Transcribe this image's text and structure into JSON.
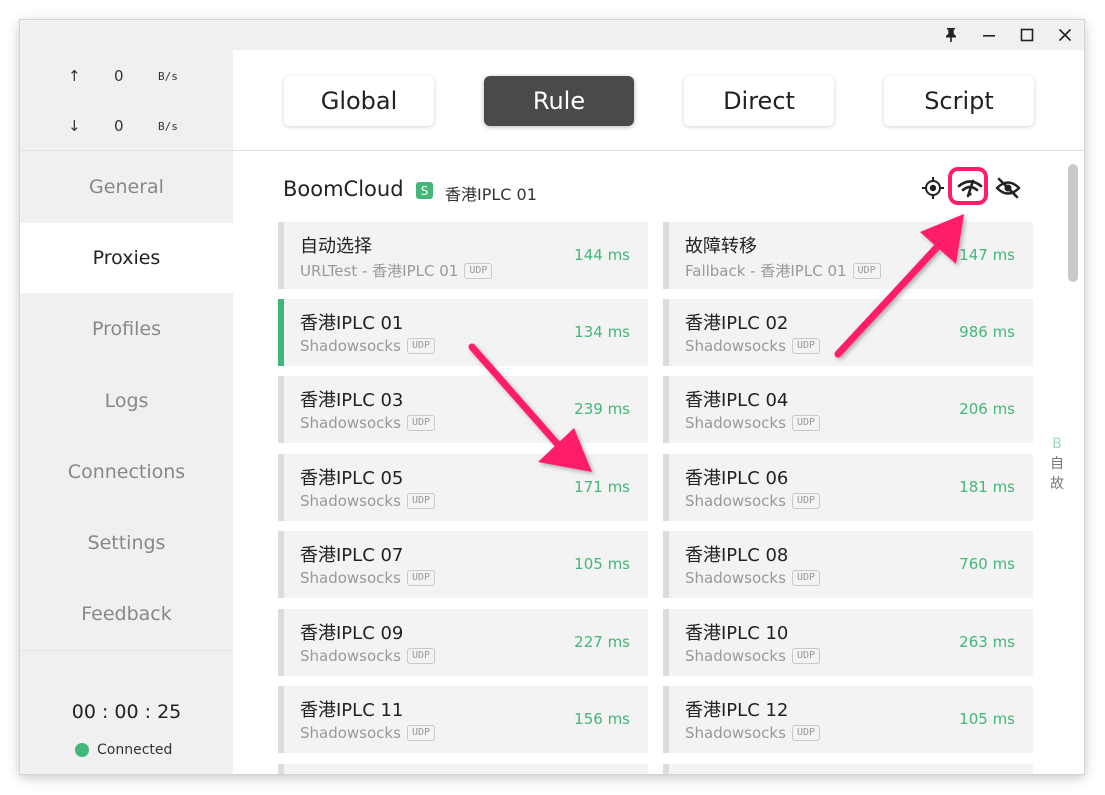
{
  "titlebar": {
    "pin_icon": "pin-icon",
    "minimize_icon": "minimize-icon",
    "maximize_icon": "maximize-icon",
    "close_icon": "close-icon"
  },
  "traffic": {
    "up_arrow": "↑",
    "up_value": "0",
    "up_unit": "B/s",
    "down_arrow": "↓",
    "down_value": "0",
    "down_unit": "B/s"
  },
  "nav": {
    "items": [
      {
        "label": "General"
      },
      {
        "label": "Proxies"
      },
      {
        "label": "Profiles"
      },
      {
        "label": "Logs"
      },
      {
        "label": "Connections"
      },
      {
        "label": "Settings"
      },
      {
        "label": "Feedback"
      }
    ],
    "active": "Proxies"
  },
  "status": {
    "timer": "00 : 00 : 25",
    "connection": "Connected",
    "dot_color": "#43b679"
  },
  "modes": {
    "items": [
      {
        "label": "Global"
      },
      {
        "label": "Rule"
      },
      {
        "label": "Direct"
      },
      {
        "label": "Script"
      }
    ],
    "active": "Rule"
  },
  "group": {
    "name": "BoomCloud",
    "badge": "S",
    "selected_proxy": "香港IPLC 01",
    "icons": [
      "locate-icon",
      "speed-test-icon",
      "hide-eye-icon"
    ]
  },
  "proxies": [
    {
      "name": "自动选择",
      "type": "URLTest - 香港IPLC 01",
      "udp": "UDP",
      "delay": "144 ms"
    },
    {
      "name": "故障转移",
      "type": "Fallback - 香港IPLC 01",
      "udp": "UDP",
      "delay": "147 ms"
    },
    {
      "name": "香港IPLC 01",
      "type": "Shadowsocks",
      "udp": "UDP",
      "delay": "134 ms"
    },
    {
      "name": "香港IPLC 02",
      "type": "Shadowsocks",
      "udp": "UDP",
      "delay": "986 ms"
    },
    {
      "name": "香港IPLC 03",
      "type": "Shadowsocks",
      "udp": "UDP",
      "delay": "239 ms"
    },
    {
      "name": "香港IPLC 04",
      "type": "Shadowsocks",
      "udp": "UDP",
      "delay": "206 ms"
    },
    {
      "name": "香港IPLC 05",
      "type": "Shadowsocks",
      "udp": "UDP",
      "delay": "171 ms"
    },
    {
      "name": "香港IPLC 06",
      "type": "Shadowsocks",
      "udp": "UDP",
      "delay": "181 ms"
    },
    {
      "name": "香港IPLC 07",
      "type": "Shadowsocks",
      "udp": "UDP",
      "delay": "105 ms"
    },
    {
      "name": "香港IPLC 08",
      "type": "Shadowsocks",
      "udp": "UDP",
      "delay": "760 ms"
    },
    {
      "name": "香港IPLC 09",
      "type": "Shadowsocks",
      "udp": "UDP",
      "delay": "227 ms"
    },
    {
      "name": "香港IPLC 10",
      "type": "Shadowsocks",
      "udp": "UDP",
      "delay": "263 ms"
    },
    {
      "name": "香港IPLC 11",
      "type": "Shadowsocks",
      "udp": "UDP",
      "delay": "156 ms"
    },
    {
      "name": "香港IPLC 12",
      "type": "Shadowsocks",
      "udp": "UDP",
      "delay": "105 ms"
    }
  ],
  "side_index": [
    "B",
    "自",
    "故"
  ],
  "colors": {
    "accent_green": "#43b679",
    "annotation_pink": "#ff1f68",
    "active_mode_bg": "#4a4a4a",
    "sidebar_bg": "#f0f0f0"
  }
}
